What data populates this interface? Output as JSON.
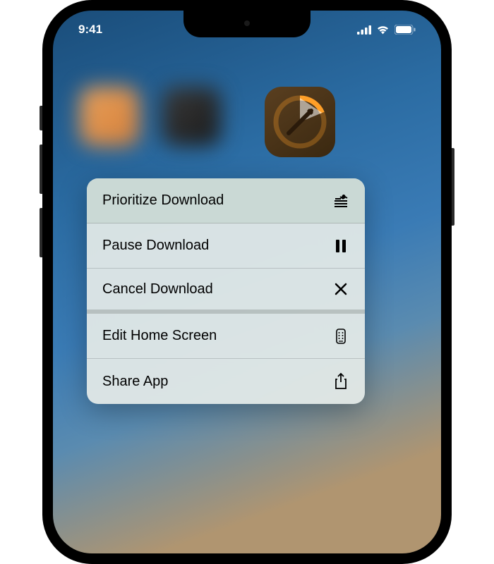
{
  "status": {
    "time": "9:41"
  },
  "menu": {
    "items": [
      {
        "label": "Prioritize Download",
        "icon": "prioritize-icon"
      },
      {
        "label": "Pause Download",
        "icon": "pause-icon"
      },
      {
        "label": "Cancel Download",
        "icon": "cancel-icon"
      },
      {
        "label": "Edit Home Screen",
        "icon": "home-screen-icon"
      },
      {
        "label": "Share App",
        "icon": "share-icon"
      }
    ]
  },
  "app": {
    "progress": 0.25
  }
}
